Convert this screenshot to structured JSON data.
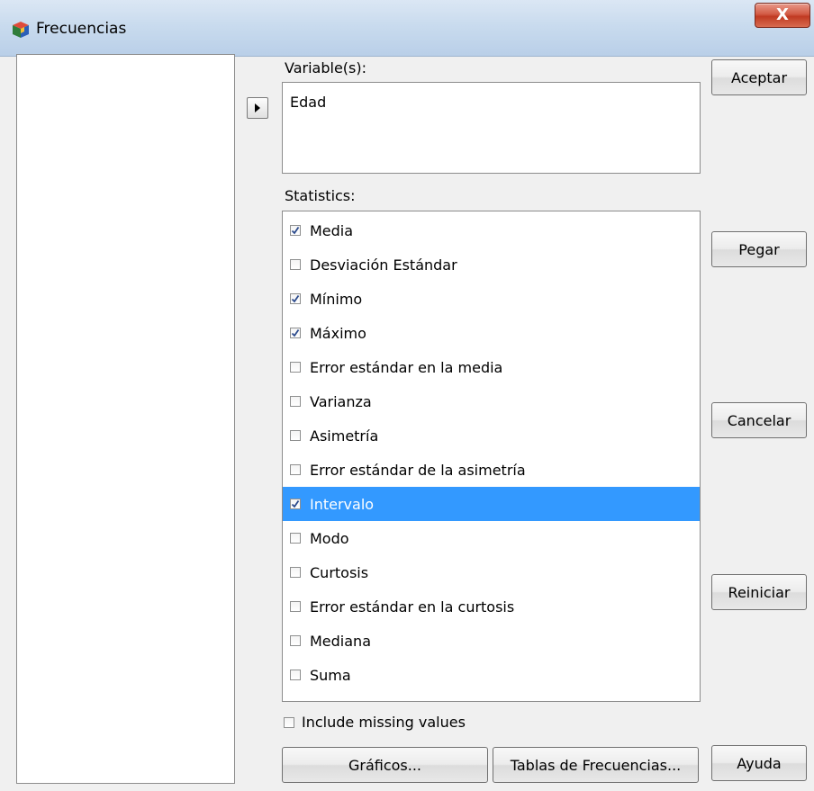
{
  "window": {
    "title": "Frecuencias",
    "icon": "spss-cube-icon",
    "close_label": "X"
  },
  "variables": {
    "label": "Variable(s):",
    "items": [
      "Edad"
    ]
  },
  "statistics": {
    "label": "Statistics:",
    "items": [
      {
        "label": "Media",
        "checked": true,
        "selected": false
      },
      {
        "label": "Desviación Estándar",
        "checked": false,
        "selected": false
      },
      {
        "label": "Mínimo",
        "checked": true,
        "selected": false
      },
      {
        "label": "Máximo",
        "checked": true,
        "selected": false
      },
      {
        "label": "Error estándar en la media",
        "checked": false,
        "selected": false
      },
      {
        "label": "Varianza",
        "checked": false,
        "selected": false
      },
      {
        "label": "Asimetría",
        "checked": false,
        "selected": false
      },
      {
        "label": "Error estándar de la asimetría",
        "checked": false,
        "selected": false
      },
      {
        "label": "Intervalo",
        "checked": true,
        "selected": true
      },
      {
        "label": "Modo",
        "checked": false,
        "selected": false
      },
      {
        "label": "Curtosis",
        "checked": false,
        "selected": false
      },
      {
        "label": "Error estándar en la curtosis",
        "checked": false,
        "selected": false
      },
      {
        "label": "Mediana",
        "checked": false,
        "selected": false
      },
      {
        "label": "Suma",
        "checked": false,
        "selected": false
      }
    ]
  },
  "include_missing": {
    "label": "Include missing values",
    "checked": false
  },
  "buttons": {
    "aceptar": "Aceptar",
    "pegar": "Pegar",
    "cancelar": "Cancelar",
    "reiniciar": "Reiniciar",
    "ayuda": "Ayuda",
    "graficos": "Gráficos...",
    "tablas": "Tablas de Frecuencias..."
  },
  "colors": {
    "selection": "#3399ff",
    "close_button": "#c73a24"
  }
}
